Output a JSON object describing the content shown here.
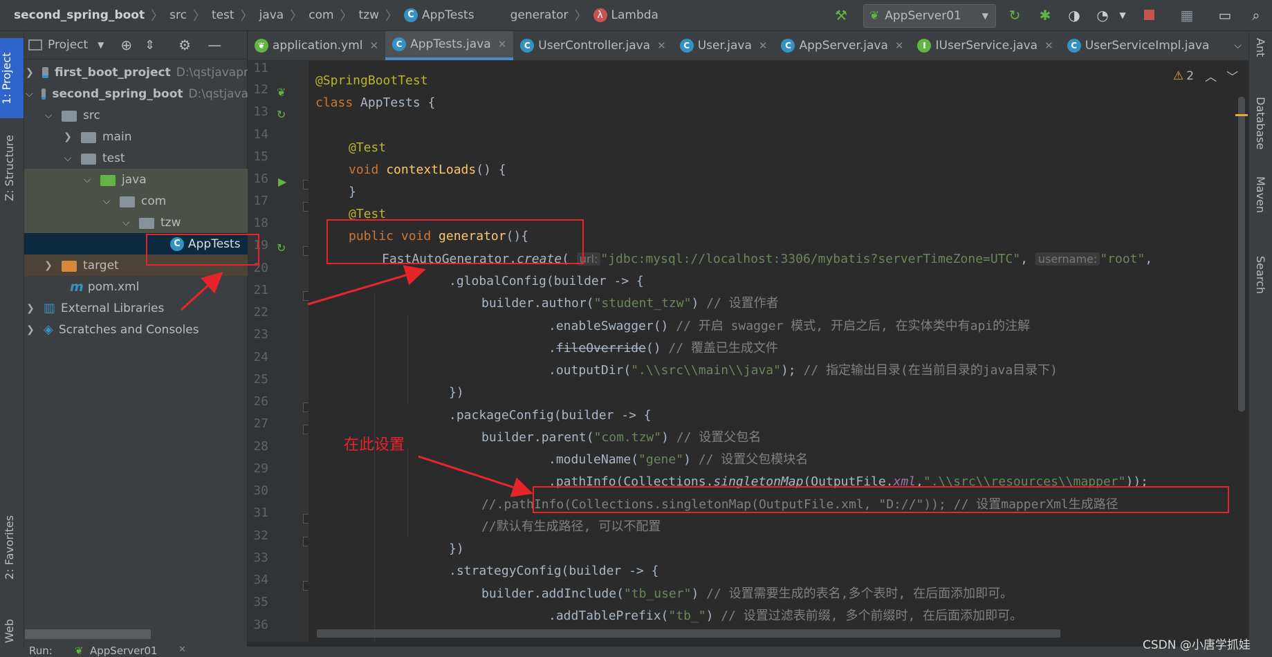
{
  "breadcrumbs": {
    "project": "second_spring_boot",
    "parts": [
      "src",
      "test",
      "java",
      "com",
      "tzw"
    ],
    "class": "AppTests",
    "method": "generator",
    "lambda": "Lambda"
  },
  "toolbar": {
    "run_config": "AppServer01"
  },
  "left_stripe": {
    "project": "1: Project",
    "structure": "Z: Structure",
    "favorites": "2: Favorites",
    "web": "Web"
  },
  "right_stripe": {
    "ant": "Ant",
    "database": "Database",
    "maven": "Maven",
    "search": "Search"
  },
  "project_panel": {
    "title": "Project",
    "tree": [
      {
        "label": "first_boot_project",
        "path": "D:\\qstjavapr"
      },
      {
        "label": "second_spring_boot",
        "path": "D:\\qstjava"
      },
      {
        "label": "src"
      },
      {
        "label": "main"
      },
      {
        "label": "test"
      },
      {
        "label": "java"
      },
      {
        "label": "com"
      },
      {
        "label": "tzw"
      },
      {
        "label": "AppTests"
      },
      {
        "label": "target"
      },
      {
        "label": "pom.xml"
      },
      {
        "label": "External Libraries"
      },
      {
        "label": "Scratches and Consoles"
      }
    ]
  },
  "tabs": [
    {
      "label": "application.yml"
    },
    {
      "label": "AppTests.java"
    },
    {
      "label": "UserController.java"
    },
    {
      "label": "User.java"
    },
    {
      "label": "AppServer.java"
    },
    {
      "label": "IUserService.java"
    },
    {
      "label": "UserServiceImpl.java"
    }
  ],
  "editor": {
    "warning_count": "2",
    "line_numbers": [
      "11",
      "12",
      "13",
      "14",
      "15",
      "16",
      "17",
      "18",
      "19",
      "20",
      "21",
      "22",
      "23",
      "24",
      "25",
      "26",
      "27",
      "28",
      "29",
      "30",
      "31",
      "32",
      "33",
      "34",
      "35",
      "36"
    ],
    "code": {
      "l12": "@SpringBootTest",
      "l13a": "class ",
      "l13b": "AppTests {",
      "l15": "@Test",
      "l16a": "void ",
      "l16b": "contextLoads",
      "l16c": "() {",
      "l17": "}",
      "l18": "@Test",
      "l19a": "public void ",
      "l19b": "generator",
      "l19c": "(){",
      "l20a": "FastAutoGenerator.",
      "l20b": "create",
      "l20c": "(",
      "l20hint1": "url:",
      "l20str1": "\"jdbc:mysql://localhost:3306/mybatis?serverTimeZone=UTC\"",
      "l20comma": ", ",
      "l20hint2": "username:",
      "l20str2": "\"root\"",
      "l20end": ",",
      "l21": ".globalConfig(builder -> {",
      "l22a": "builder.author(",
      "l22b": "\"student_tzw\"",
      "l22c": ") ",
      "l22d": "// 设置作者",
      "l23a": ".enableSwagger() ",
      "l23b": "// 开启 swagger 模式, 开启之后, 在实体类中有api的注解",
      "l24a": ".",
      "l24b": "fileOverride",
      "l24c": "() ",
      "l24d": "// 覆盖已生成文件",
      "l25a": ".outputDir(",
      "l25b": "\".\\\\src\\\\main\\\\java\"",
      "l25c": "); ",
      "l25d": "// 指定输出目录(在当前目录的java目录下)",
      "l26": "})",
      "l27": ".packageConfig(builder -> {",
      "l28a": "builder.parent(",
      "l28b": "\"com.tzw\"",
      "l28c": ") ",
      "l28d": "// 设置父包名",
      "l29a": ".moduleName(",
      "l29b": "\"gene\"",
      "l29c": ") ",
      "l29d": "// 设置父包模块名",
      "l30a": ".pathInfo(Collections.",
      "l30b": "singletonMap",
      "l30c": "(OutputFile.",
      "l30d": "xml",
      "l30e": ",",
      "l30f": "\".\\\\src\\\\resources\\\\mapper\"",
      "l30g": "));",
      "l31": "//.pathInfo(Collections.singletonMap(OutputFile.xml, \"D://\")); // 设置mapperXml生成路径",
      "l32": "//默认有生成路径, 可以不配置",
      "l33": "})",
      "l34": ".strategyConfig(builder -> {",
      "l35a": "builder.addInclude(",
      "l35b": "\"tb_user\"",
      "l35c": ") ",
      "l35d": "// 设置需要生成的表名,多个表时, 在后面添加即可。",
      "l36a": ".addTablePrefix(",
      "l36b": "\"tb_\"",
      "l36c": ") ",
      "l36d": "// 设置过滤表前缀, 多个前缀时, 在后面添加即可。"
    }
  },
  "annotation": {
    "label": "在此设置"
  },
  "bottom": {
    "run_label": "Run:",
    "run_tab": "AppServer01",
    "watermark": "CSDN @小唐学抓娃"
  }
}
